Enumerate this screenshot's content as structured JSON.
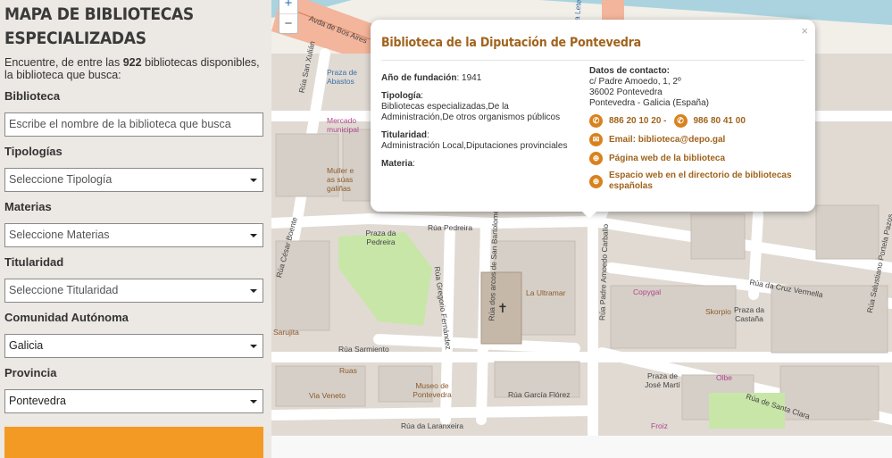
{
  "sidebar": {
    "title_line1": "MAPA DE BIBLIOTECAS",
    "title_line2": "ESPECIALIZADAS",
    "intro_pre": "Encuentre, de entre las ",
    "intro_count": "922",
    "intro_post": " bibliotecas disponibles, la biblioteca que busca:",
    "biblioteca_label": "Biblioteca",
    "biblioteca_placeholder": "Escribe el nombre de la biblioteca que busca",
    "tipologias_label": "Tipologías",
    "tipologias_value": "Seleccione Tipología",
    "materias_label": "Materias",
    "materias_value": "Seleccione Materias",
    "titularidad_label": "Titularidad",
    "titularidad_value": "Seleccione Titularidad",
    "comunidad_label": "Comunidad Autónoma",
    "comunidad_value": "Galicia",
    "provincia_label": "Provincia",
    "provincia_value": "Pontevedra"
  },
  "map": {
    "zoom_in": "+",
    "zoom_out": "−",
    "labels": [
      "Rúa San Xulián",
      "Praza de Abastos",
      "Mercado municipal",
      "Muller e as súas galiñas",
      "Rúa Pedreira",
      "Praza da Pedreira",
      "Rúa César Boente",
      "Rúa Gregorio Fernández",
      "Rúa dos arcos de San Bartolomé",
      "La Ultramar",
      "Rúa Padre Amoedo Carballo",
      "Copygal",
      "Rúa da Cruz Vermella",
      "Praza da Castaña",
      "Skorpio",
      "Rúa Salustiano Portela Pazos",
      "Rúa Sarmiento",
      "Ruas",
      "Via Veneto",
      "Museo de Pontevedra",
      "Rúa García Flórez",
      "Rúa da Laranxeira",
      "Praza de José Martí",
      "Rúa de Santa Clara",
      "Olbe",
      "Froiz",
      "Avda de Bos Aires",
      "Rúa Letelier",
      "Sarujita"
    ]
  },
  "popup": {
    "title": "Biblioteca de la Diputación de Pontevedra",
    "close": "×",
    "fundacion_key": "Año de fundación",
    "fundacion_val": "1941",
    "tipologia_key": "Tipología",
    "tipologia_val": "Bibliotecas especializadas,De la Administración,De otros organismos públicos",
    "titularidad_key": "Titularidad",
    "titularidad_val": "Administración Local,Diputaciones provinciales",
    "materia_key": "Materia",
    "contacto_key": "Datos de contacto:",
    "addr1": "c/ Padre Amoedo, 1, 2º",
    "addr2": "36002 Pontevedra",
    "addr3": "Pontevedra - Galicia (España)",
    "phone1": "886 20 10 20 -",
    "phone2": "986 80 41 00",
    "email": "Email: biblioteca@depo.gal",
    "web": "Página web de la biblioteca",
    "directorio": "Espacio web en el directorio de bibliotecas españolas"
  },
  "colors": {
    "accent": "#a0631c",
    "button": "#f39a25",
    "sidebar_bg": "#ece8e3",
    "water": "#aad3df"
  }
}
